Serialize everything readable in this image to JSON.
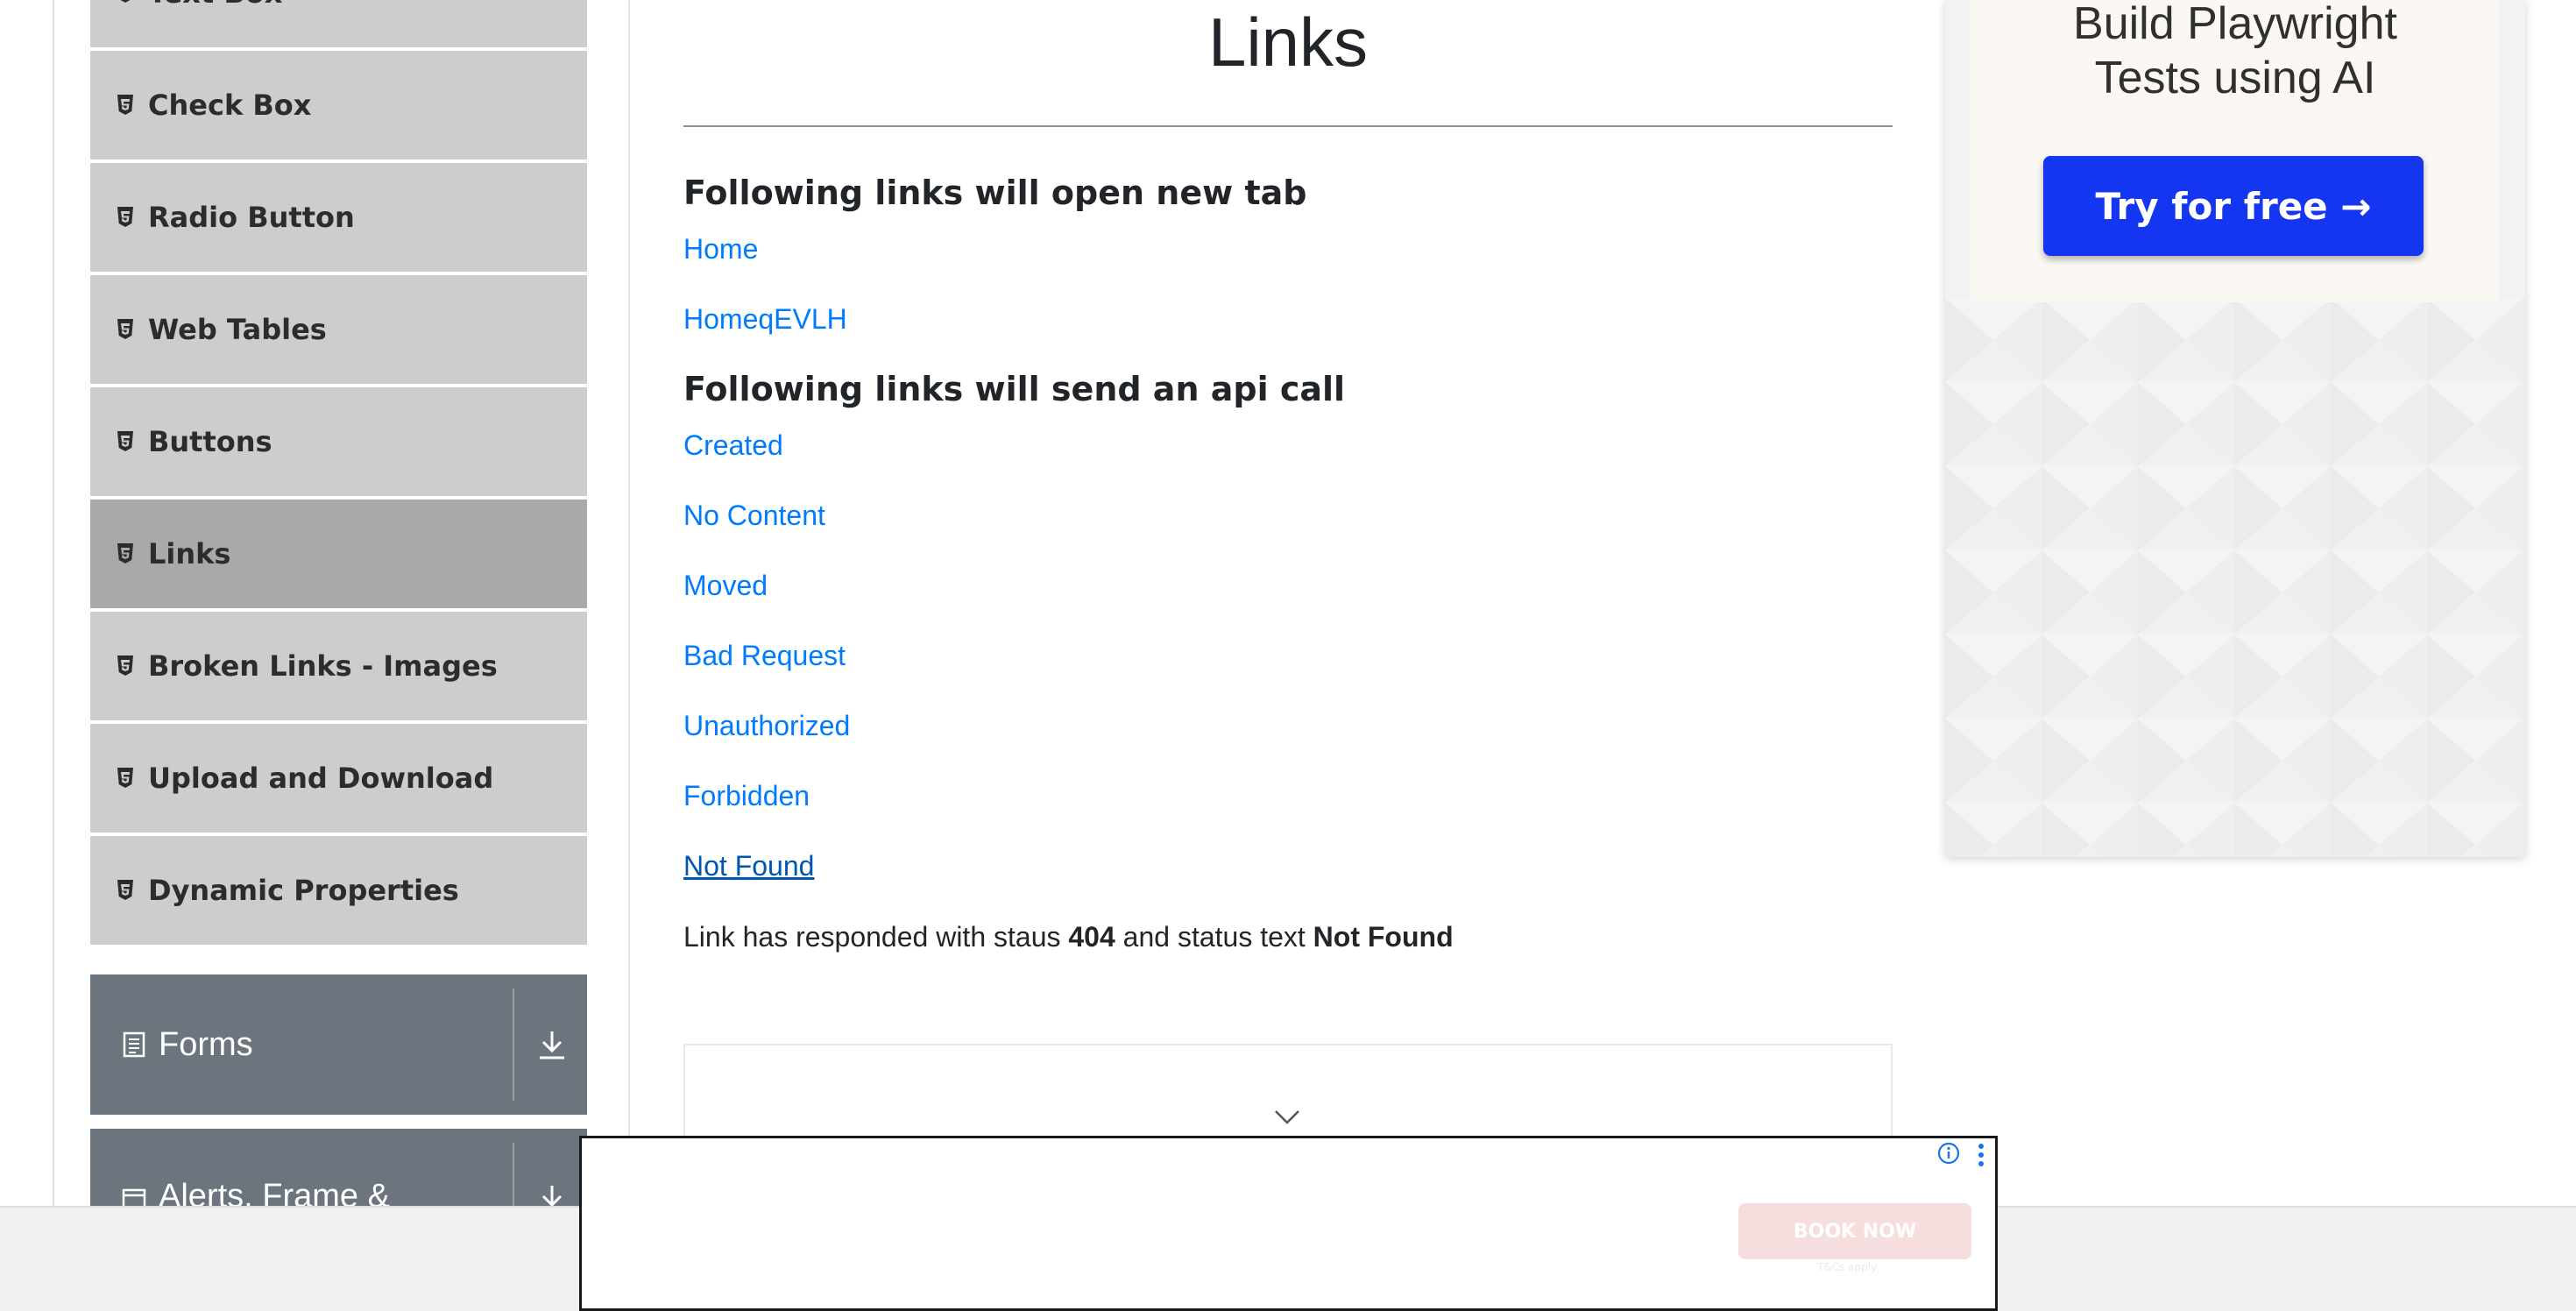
{
  "sidebar": {
    "items": [
      {
        "label": "Text Box",
        "active": false
      },
      {
        "label": "Check Box",
        "active": false
      },
      {
        "label": "Radio Button",
        "active": false
      },
      {
        "label": "Web Tables",
        "active": false
      },
      {
        "label": "Buttons",
        "active": false
      },
      {
        "label": "Links",
        "active": true
      },
      {
        "label": "Broken Links - Images",
        "active": false
      },
      {
        "label": "Upload and Download",
        "active": false
      },
      {
        "label": "Dynamic Properties",
        "active": false
      }
    ],
    "groups": [
      {
        "label": "Forms"
      },
      {
        "label": "Alerts, Frame &"
      }
    ]
  },
  "main": {
    "title": "Links",
    "section_new_tab": "Following links will open new tab",
    "new_tab_links": [
      "Home",
      "HomeqEVLH"
    ],
    "section_api": "Following links will send an api call",
    "api_links": [
      "Created",
      "No Content",
      "Moved",
      "Bad Request",
      "Unauthorized",
      "Forbidden",
      "Not Found"
    ],
    "response": {
      "prefix": "Link has responded with staus",
      "code": "404",
      "middle": "and status text",
      "status_text": "Not Found"
    }
  },
  "right_ad": {
    "title_line1": "Build Playwright",
    "title_line2": "Tests using AI",
    "cta": "Try for free →"
  },
  "bottom_ad": {
    "button": "BOOK NOW",
    "fine_print": "T&Cs apply"
  },
  "colors": {
    "link": "#007bff",
    "sidebar_item": "#cdcdcd",
    "sidebar_active": "#a9a9a9",
    "group_header": "#6c757d",
    "cta": "#1436f0"
  }
}
